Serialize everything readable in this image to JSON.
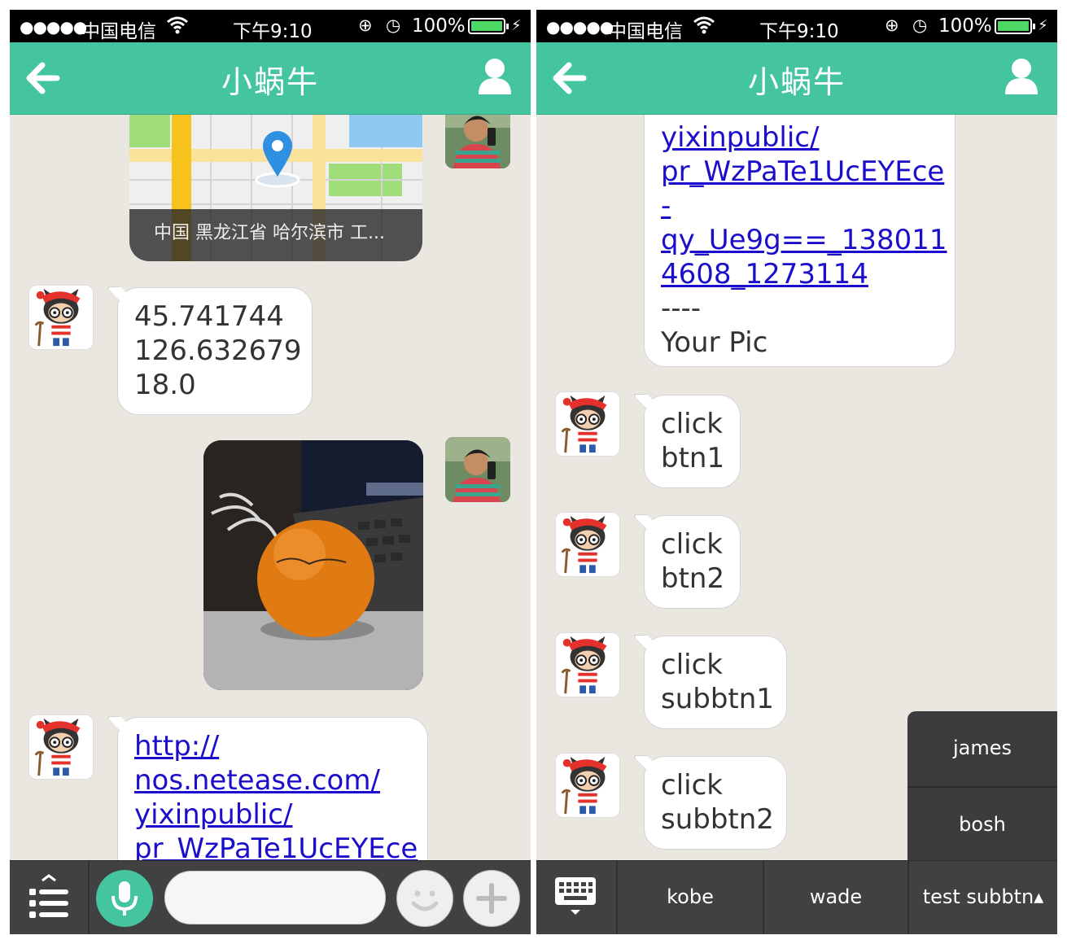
{
  "status_bar": {
    "signal": "●●●●●",
    "carrier": "中国电信",
    "time": "下午9:10",
    "battery_level": "100%",
    "lock_glyph": "⊕",
    "alarm_glyph": "◷"
  },
  "header": {
    "title": "小蜗牛"
  },
  "left_screen": {
    "map_caption": "中国 黑龙江省 哈尔滨市 工...",
    "coords_message": [
      "45.741744",
      "126.632679",
      "18.0"
    ],
    "link_message": [
      "http://",
      "nos.netease.com/",
      "yixinpublic/",
      "pr_WzPaTe1UcEYEce"
    ]
  },
  "right_screen": {
    "link_message": [
      "yixinpublic/",
      "pr_WzPaTe1UcEYEce",
      "-",
      "qy_Ue9g==_138011",
      "4608_1273114"
    ],
    "separator": "----",
    "your_pic": "Your Pic",
    "replies": [
      [
        "click",
        "btn1"
      ],
      [
        "click",
        "btn2"
      ],
      [
        "click",
        "subbtn1"
      ],
      [
        "click",
        "subbtn2"
      ]
    ],
    "menu": {
      "items": [
        "kobe",
        "wade",
        "test subbtn▴"
      ],
      "submenu": [
        "james",
        "bosh"
      ]
    }
  },
  "colors": {
    "accent": "#45c4a0",
    "link": "#1a0dcc",
    "bar": "#414141"
  }
}
